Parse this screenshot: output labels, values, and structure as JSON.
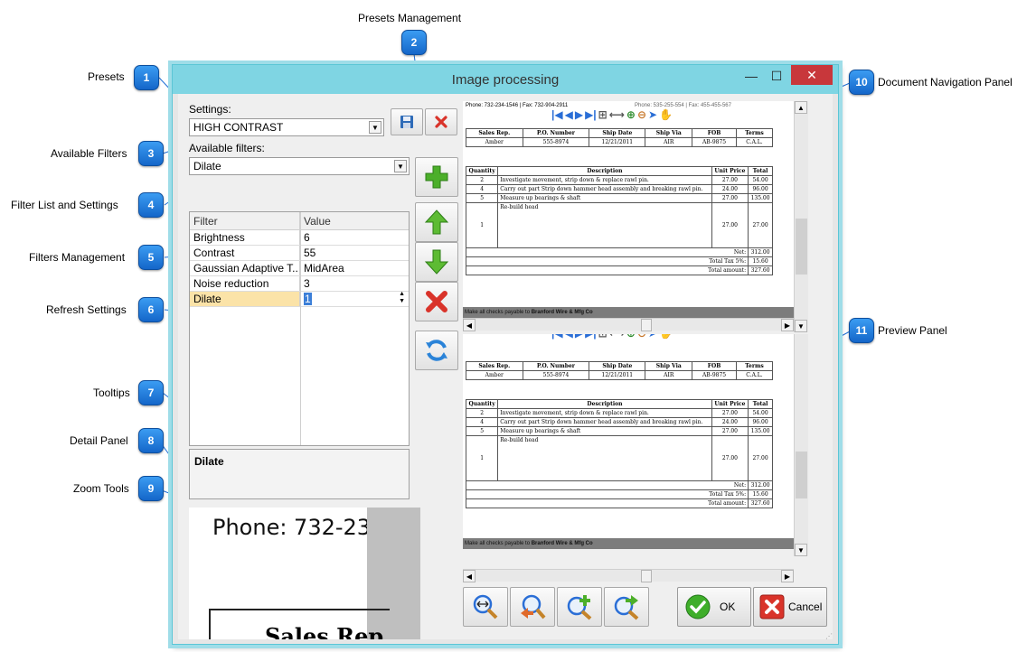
{
  "callouts": [
    {
      "number": "1",
      "label": "Presets"
    },
    {
      "number": "2",
      "label": "Presets Management"
    },
    {
      "number": "3",
      "label": "Available Filters"
    },
    {
      "number": "4",
      "label": "Filter List and Settings"
    },
    {
      "number": "5",
      "label": "Filters Management"
    },
    {
      "number": "6",
      "label": "Refresh Settings"
    },
    {
      "number": "7",
      "label": "Tooltips"
    },
    {
      "number": "8",
      "label": "Detail Panel"
    },
    {
      "number": "9",
      "label": "Zoom Tools"
    },
    {
      "number": "10",
      "label": "Document Navigation Panel"
    },
    {
      "number": "11",
      "label": "Preview Panel"
    }
  ],
  "colors": {
    "badge": "#1f7de0",
    "titlebar": "#7fd5e3",
    "close": "#c8373b",
    "selected_row": "#fbe3a8",
    "plus": "#4caf2a",
    "delete": "#d9332a"
  },
  "window": {
    "title": "Image processing",
    "minimize": "—",
    "maximize": "☐",
    "close": "✕"
  },
  "settings": {
    "label": "Settings:",
    "value": "HIGH CONTRAST"
  },
  "filters": {
    "label": "Available filters:",
    "value": "Dilate"
  },
  "grid": {
    "columns": [
      "Filter",
      "Value"
    ],
    "rows": [
      {
        "filter": "Brightness",
        "value": "6"
      },
      {
        "filter": "Contrast",
        "value": "55"
      },
      {
        "filter": "Gaussian Adaptive T...",
        "value": "MidArea"
      },
      {
        "filter": "Noise reduction",
        "value": "3"
      },
      {
        "filter": "Dilate",
        "value": "1"
      }
    ],
    "selected_index": 4
  },
  "tooltip": {
    "text": "Dilate"
  },
  "detail": {
    "phone": "Phone: 732-23",
    "sales_rep": "Sales Rep"
  },
  "document": {
    "header_line": "Phone: 732-234-1546 | Fax: 732-904-2911",
    "header_right": "Phone: 535-255-554 | Fax: 455-455-567",
    "top_columns": [
      "Sales Rep.",
      "P.O. Number",
      "Ship Date",
      "Ship Via",
      "FOB",
      "Terms"
    ],
    "top_values": [
      "Amber",
      "555-8974",
      "12/21/2011",
      "AIR",
      "AB-9875",
      "C.A.L."
    ],
    "item_columns": [
      "Quantity",
      "Description",
      "Unit Price",
      "Total"
    ],
    "items": [
      {
        "qty": "2",
        "desc": "Investigate movement, strip down & replace rawl pin.",
        "price": "27.00",
        "total": "54.00"
      },
      {
        "qty": "4",
        "desc": "Carry out part Strip down hammer head assembly and breaking rawl pin.",
        "price": "24.00",
        "total": "96.00"
      },
      {
        "qty": "5",
        "desc": "Measure up bearings & shaft",
        "price": "27.00",
        "total": "135.00"
      },
      {
        "qty": "1",
        "desc": "Re-build head",
        "price": "27.00",
        "total": "27.00"
      }
    ],
    "totals": [
      {
        "label": "Net:",
        "value": "312.00"
      },
      {
        "label": "Total Tax 5%:",
        "value": "15.60"
      },
      {
        "label": "Total amount:",
        "value": "327.60"
      }
    ],
    "footer": "Make all checks payable to",
    "footer_bold": "Branford Wire & Mfg Co"
  },
  "buttons": {
    "ok": "OK",
    "cancel": "Cancel"
  }
}
